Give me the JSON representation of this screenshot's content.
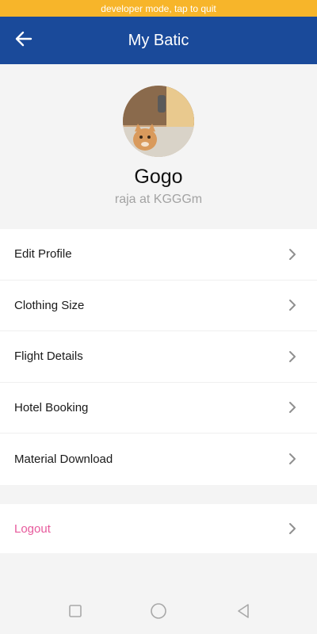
{
  "status": {
    "developer_banner": "developer mode, tap to quit"
  },
  "header": {
    "title": "My Batic",
    "back_icon": "arrow-left-icon",
    "background": "#1a4a9a"
  },
  "profile": {
    "name": "Gogo",
    "subtitle": "raja at KGGGm",
    "avatar_icon": "user-avatar-photo"
  },
  "menu": {
    "items": [
      {
        "label": "Edit Profile",
        "icon": "chevron-right-icon"
      },
      {
        "label": "Clothing Size",
        "icon": "chevron-right-icon"
      },
      {
        "label": "Flight Details",
        "icon": "chevron-right-icon"
      },
      {
        "label": "Hotel Booking",
        "icon": "chevron-right-icon"
      },
      {
        "label": "Material Download",
        "icon": "chevron-right-icon"
      }
    ]
  },
  "logout": {
    "label": "Logout",
    "color": "#e75a9c",
    "icon": "chevron-right-icon"
  },
  "system_nav": {
    "recent": "square-icon",
    "home": "circle-icon",
    "back": "triangle-back-icon"
  },
  "colors": {
    "banner": "#f7b52a",
    "accent": "#1a4a9a"
  }
}
